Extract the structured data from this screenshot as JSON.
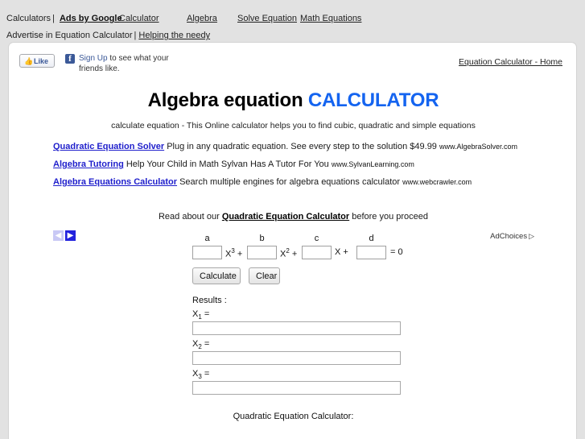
{
  "topbar": {
    "calculators_label": "Calculators",
    "separator": "|",
    "ads_by_google": "Ads by Google",
    "nav": [
      {
        "label": "Calculator"
      },
      {
        "label": "Algebra"
      },
      {
        "label": "Solve Equation"
      },
      {
        "label": "Math Equations"
      }
    ],
    "advertise_label": "Advertise in Equation Calculator",
    "helping_label": "Helping the needy"
  },
  "facebook": {
    "like_label": "Like",
    "thumb_icon": "thumbs-up-icon",
    "badge_letter": "f",
    "signup_label": "Sign Up",
    "text_rest": " to see what your friends like."
  },
  "home_link": "Equation Calculator - Home",
  "title": {
    "main": "Algebra equation ",
    "accent": "CALCULATOR",
    "accent_color": "#1464f0",
    "subtitle": "calculate equation - This Online calculator helps you to find cubic, quadratic and simple equations"
  },
  "ads": {
    "items": [
      {
        "title": "Quadratic Equation Solver",
        "description": " Plug in any quadratic equation. See every step to the solution $49.99 ",
        "url": "www.AlgebraSolver.com"
      },
      {
        "title": "Algebra Tutoring",
        "description": " Help Your Child in Math Sylvan Has A Tutor For You ",
        "url": "www.SylvanLearning.com"
      },
      {
        "title": "Algebra Equations Calculator",
        "description": " Search multiple engines for algebra equations calculator ",
        "url": "www.webcrawler.com"
      }
    ],
    "pager": {
      "prev_glyph": "◀",
      "next_glyph": "▶"
    },
    "adchoices_label": "AdChoices",
    "adchoices_icon": "▷"
  },
  "readabout": {
    "prefix": "Read about our ",
    "link": "Quadratic Equation Calculator",
    "suffix": " before you proceed"
  },
  "equation": {
    "coefficients": [
      {
        "label": "a",
        "value": "",
        "term": "X³ +",
        "exponent": "3"
      },
      {
        "label": "b",
        "value": "",
        "term": "X² +",
        "exponent": "2"
      },
      {
        "label": "c",
        "value": "",
        "term": "X +",
        "exponent": ""
      },
      {
        "label": "d",
        "value": "",
        "term": "= 0",
        "exponent": ""
      }
    ],
    "term_a": "X",
    "term_a_sup": "3",
    "term_a_op": " +",
    "term_b": "X",
    "term_b_sup": "2",
    "term_b_op": " +",
    "term_c": "X +",
    "term_d": "= 0"
  },
  "buttons": {
    "calculate": "Calculate",
    "clear": "Clear"
  },
  "results": {
    "heading": "Results :",
    "rows": [
      {
        "label": "X",
        "sub": "1",
        "eq": " =",
        "value": ""
      },
      {
        "label": "X",
        "sub": "2",
        "eq": " =",
        "value": ""
      },
      {
        "label": "X",
        "sub": "3",
        "eq": " =",
        "value": ""
      }
    ]
  },
  "footer": {
    "heading": "Quadratic Equation Calculator:"
  }
}
